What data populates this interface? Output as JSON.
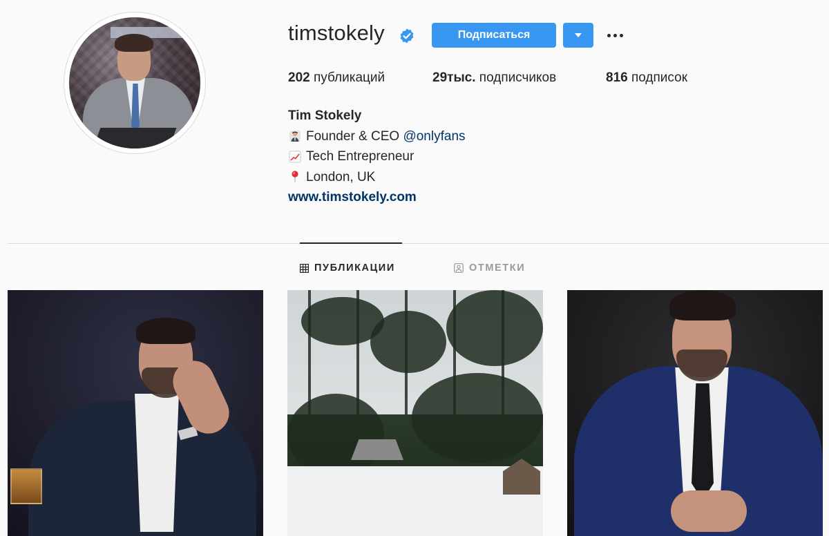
{
  "profile": {
    "username": "timstokely",
    "verified": true,
    "follow_label": "Подписаться",
    "stats": {
      "posts_count": "202",
      "posts_label": "публикаций",
      "followers_count": "29тыс.",
      "followers_label": "подписчиков",
      "following_count": "816",
      "following_label": "подписок"
    },
    "bio": {
      "name": "Tim Stokely",
      "line1_text": "Founder & CEO",
      "line1_mention": "@onlyfans",
      "line2_text": "Tech Entrepreneur",
      "line3_text": "London, UK",
      "website": "www.timstokely.com"
    }
  },
  "tabs": {
    "posts_label": "ПУБЛИКАЦИИ",
    "tagged_label": "ОТМЕТКИ"
  },
  "colors": {
    "accent": "#3897f0",
    "link": "#003569",
    "background": "#fafafa",
    "text": "#262626",
    "muted": "#999999"
  },
  "icons": {
    "verified": "verified-badge-icon",
    "dropdown": "chevron-down-icon",
    "more": "more-options-icon",
    "posts_tab": "grid-icon",
    "tagged_tab": "tagged-person-icon",
    "bio_line1": "man-in-suit-emoji",
    "bio_line2": "chart-increasing-emoji",
    "bio_line3": "pin-emoji"
  }
}
